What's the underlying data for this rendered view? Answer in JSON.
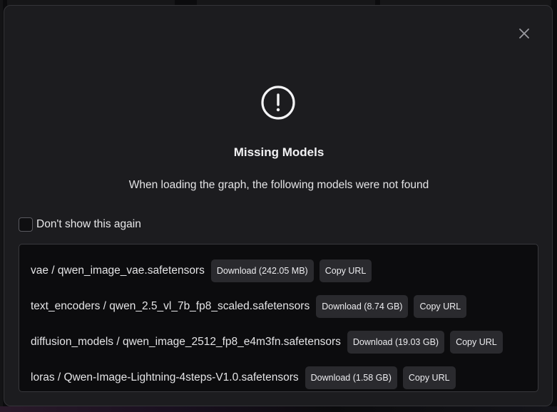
{
  "dialog": {
    "title": "Missing Models",
    "subtitle": "When loading the graph, the following models were not found",
    "dont_show_label": "Don't show this again",
    "dont_show_checked": false
  },
  "models": [
    {
      "name": "vae / qwen_image_vae.safetensors",
      "download_label": "Download (242.05 MB)",
      "copy_label": "Copy URL"
    },
    {
      "name": "text_encoders / qwen_2.5_vl_7b_fp8_scaled.safetensors",
      "download_label": "Download (8.74 GB)",
      "copy_label": "Copy URL"
    },
    {
      "name": "diffusion_models / qwen_image_2512_fp8_e4m3fn.safetensors",
      "download_label": "Download (19.03 GB)",
      "copy_label": "Copy URL"
    },
    {
      "name": "loras / Qwen-Image-Lightning-4steps-V1.0.safetensors",
      "download_label": "Download (1.58 GB)",
      "copy_label": "Copy URL"
    }
  ],
  "icons": {
    "close": "close-icon",
    "alert": "alert-circle-icon"
  },
  "colors": {
    "dialog_bg": "#1c1c1f",
    "list_bg": "#0c0c0e",
    "button_bg": "#2a2a2e",
    "text": "#e8e8ea"
  }
}
